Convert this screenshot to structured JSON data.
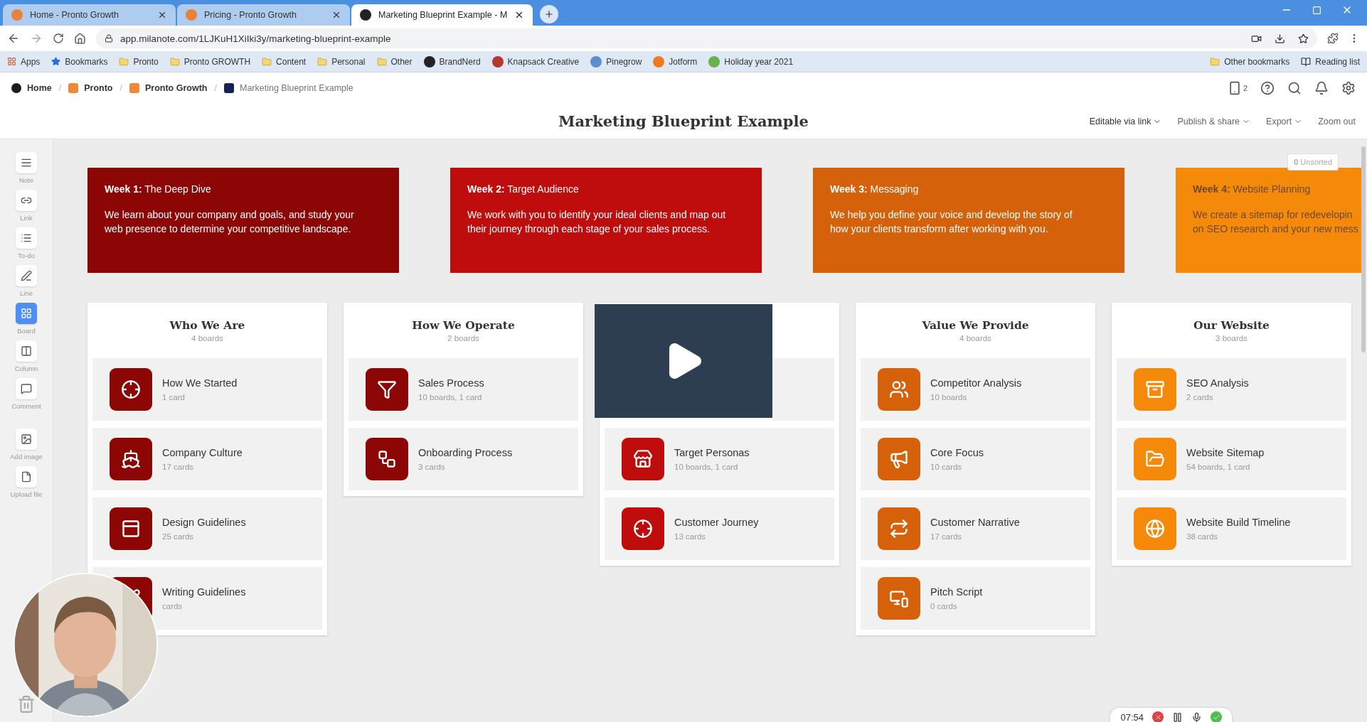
{
  "browser": {
    "tabs": [
      {
        "title": "Home - Pronto Growth",
        "selected": false
      },
      {
        "title": "Pricing - Pronto Growth",
        "selected": false
      },
      {
        "title": "Marketing Blueprint Example - M",
        "selected": true
      }
    ],
    "url": "app.milanote.com/1LJKuH1XiIki3y/marketing-blueprint-example",
    "bookmarks": [
      {
        "label": "Apps",
        "kind": "apps"
      },
      {
        "label": "Bookmarks",
        "kind": "star"
      },
      {
        "label": "Pronto",
        "kind": "folder"
      },
      {
        "label": "Pronto GROWTH",
        "kind": "folder"
      },
      {
        "label": "Content",
        "kind": "folder"
      },
      {
        "label": "Personal",
        "kind": "folder"
      },
      {
        "label": "Other",
        "kind": "folder"
      },
      {
        "label": "BrandNerd",
        "kind": "site",
        "color": "#222222"
      },
      {
        "label": "Knapsack Creative",
        "kind": "site",
        "color": "#b5382c"
      },
      {
        "label": "Pinegrow",
        "kind": "site",
        "color": "#5d8fd0"
      },
      {
        "label": "Jotform",
        "kind": "site",
        "color": "#f07a1c"
      },
      {
        "label": "Holiday year 2021",
        "kind": "site",
        "color": "#6ab04c"
      }
    ],
    "other_bookmarks": "Other bookmarks",
    "reading_list": "Reading list"
  },
  "breadcrumb": [
    {
      "label": "Home",
      "color": "#1c1c1c",
      "current": false
    },
    {
      "separator": "/",
      "label": "Pronto",
      "color": "#f0883a",
      "current": false
    },
    {
      "separator": "/",
      "label": "Pronto Growth",
      "color": "#f0883a",
      "current": false
    },
    {
      "separator": "/",
      "label": "Marketing Blueprint Example",
      "color": "#14215a",
      "current": true
    }
  ],
  "device_count": "2",
  "board_title": "Marketing Blueprint Example",
  "menu": [
    {
      "label": "Editable via link",
      "strong": true
    },
    {
      "label": "Publish & share",
      "strong": false
    },
    {
      "label": "Export",
      "strong": false
    },
    {
      "label": "Zoom out",
      "strong": false,
      "caret": false
    }
  ],
  "tools": [
    {
      "label": "Note",
      "selected": false
    },
    {
      "label": "Link",
      "selected": false
    },
    {
      "label": "To-do",
      "selected": false
    },
    {
      "label": "Line",
      "selected": false
    },
    {
      "label": "Board",
      "selected": true
    },
    {
      "label": "Column",
      "selected": false
    },
    {
      "label": "Comment",
      "selected": false
    },
    {
      "label": "Add image",
      "selected": false
    },
    {
      "label": "Upload file",
      "selected": false
    }
  ],
  "unsorted": {
    "count": "0",
    "label": "Unsorted"
  },
  "weeks": [
    {
      "heading": "**Week 1:** The Deep Dive",
      "lines": [
        "We learn about your company and goals, and study your",
        "web presence to determine your competitive landscape."
      ],
      "color": "#8c0606",
      "dim": false
    },
    {
      "heading": "**Week 2:** Target Audience",
      "lines": [
        "We work with you to identify your ideal clients and map out",
        "their journey through each stage of your sales process."
      ],
      "color": "#bf0c0c",
      "dim": false
    },
    {
      "heading": "**Week 3:** Messaging",
      "lines": [
        "We help you define your voice and develop the story of",
        "how your clients transform after working with you."
      ],
      "color": "#d5620a",
      "dim": false
    },
    {
      "heading": "**Week 4:** Website Planning",
      "lines": [
        "We create a sitemap for redevelopin",
        "on SEO research and your new mess"
      ],
      "color": "#f5890a",
      "dim": true
    }
  ],
  "columns": [
    {
      "title": "Who We Are",
      "subtitle": "4 boards",
      "color": "#8c0606",
      "items": [
        {
          "title": "How We Started",
          "meta": "1 card"
        },
        {
          "title": "Company Culture",
          "meta": "17 cards"
        },
        {
          "title": "Design Guidelines",
          "meta": "25 cards"
        },
        {
          "title": "Writing Guidelines",
          "meta": "cards"
        }
      ]
    },
    {
      "title": "How We Operate",
      "subtitle": "2 boards",
      "color": "#8c0606",
      "items": [
        {
          "title": "Sales Process",
          "meta": "10 boards, 1 card"
        },
        {
          "title": "Onboarding Process",
          "meta": "3 cards"
        }
      ]
    },
    {
      "color": "#bf0c0c",
      "items": [
        {
          "title": "Target Personas",
          "meta": "10 boards, 1 card"
        },
        {
          "title": "Customer Journey",
          "meta": "13 cards"
        }
      ]
    },
    {
      "title": "Value We Provide",
      "subtitle": "4 boards",
      "color": "#d5620a",
      "items": [
        {
          "title": "Competitor Analysis",
          "meta": "10 boards"
        },
        {
          "title": "Core Focus",
          "meta": "10 cards"
        },
        {
          "title": "Customer Narrative",
          "meta": "17 cards"
        },
        {
          "title": "Pitch Script",
          "meta": "0 cards"
        }
      ]
    },
    {
      "title": "Our Website",
      "subtitle": "3 boards",
      "color": "#f5890a",
      "items": [
        {
          "title": "SEO Analysis",
          "meta": "2 cards"
        },
        {
          "title": "Website Sitemap",
          "meta": "54 boards, 1 card"
        },
        {
          "title": "Website Build Timeline",
          "meta": "38 cards"
        }
      ]
    }
  ],
  "recorder": {
    "time": "07:54"
  }
}
